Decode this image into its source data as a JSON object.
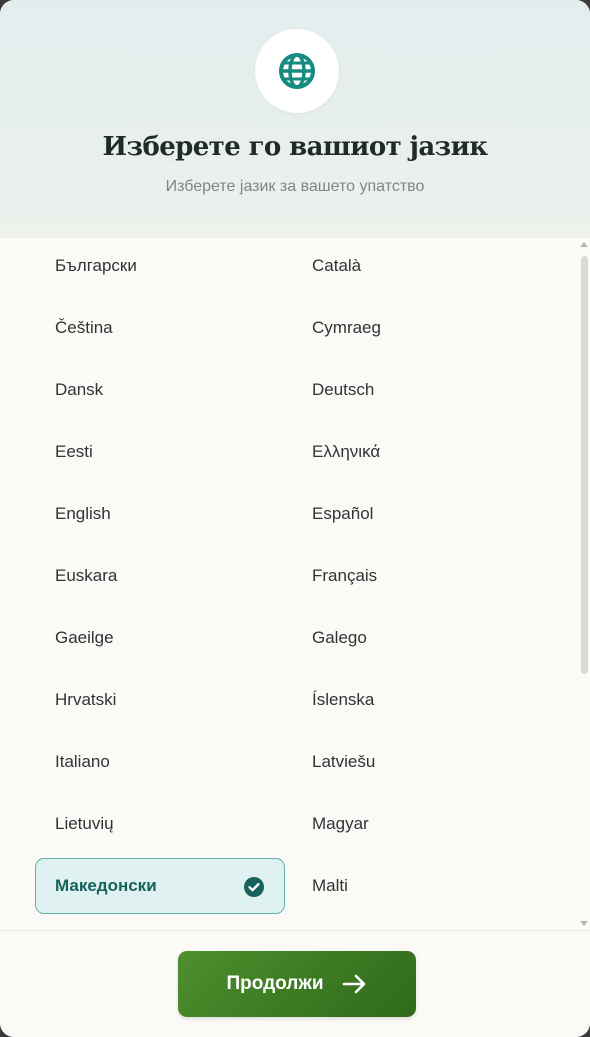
{
  "header": {
    "icon": "globe-icon",
    "title": "Изберете го вашиот јазик",
    "subtitle": "Изберете јазик за вашето упатство"
  },
  "languages": [
    {
      "label": "Български"
    },
    {
      "label": "Català"
    },
    {
      "label": "Čeština"
    },
    {
      "label": "Cymraeg"
    },
    {
      "label": "Dansk"
    },
    {
      "label": "Deutsch"
    },
    {
      "label": "Eesti"
    },
    {
      "label": "Ελληνικά"
    },
    {
      "label": "English"
    },
    {
      "label": "Español"
    },
    {
      "label": "Euskara"
    },
    {
      "label": "Français"
    },
    {
      "label": "Gaeilge"
    },
    {
      "label": "Galego"
    },
    {
      "label": "Hrvatski"
    },
    {
      "label": "Íslenska"
    },
    {
      "label": "Italiano"
    },
    {
      "label": "Latviešu"
    },
    {
      "label": "Lietuvių"
    },
    {
      "label": "Magyar"
    },
    {
      "label": "Македонски",
      "selected": true
    },
    {
      "label": "Malti"
    }
  ],
  "footer": {
    "continue_label": "Продолжи",
    "continue_icon": "arrow-right-icon"
  },
  "colors": {
    "accent": "#1a8f84",
    "button": "#3c7a22",
    "selected_bg": "#dff2f1",
    "selected_border": "#5fb4ad"
  }
}
